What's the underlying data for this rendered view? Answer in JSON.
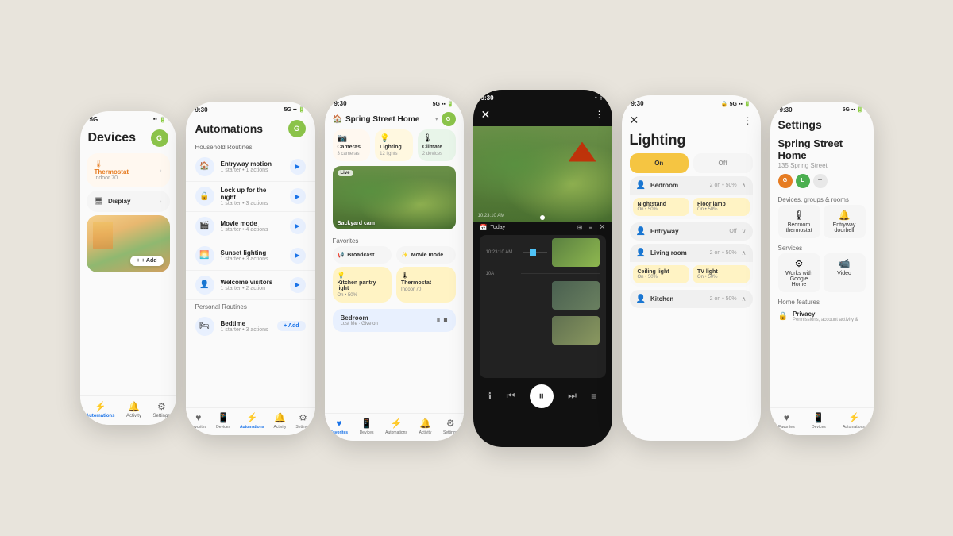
{
  "background": "#e8e4dc",
  "phones": {
    "phone1": {
      "title": "Devices",
      "status_time": "5G",
      "thermostat_label": "Thermostat",
      "thermostat_sub": "Indoor 70",
      "display_label": "Display",
      "add_label": "+ Add",
      "nav": [
        "Automations",
        "Activity",
        "Settings"
      ]
    },
    "phone2": {
      "title": "Automations",
      "status_time": "9:30",
      "section1": "Household Routines",
      "section2": "Personal Routines",
      "items": [
        {
          "name": "Entryway motion",
          "sub": "1 starter • 1 actions"
        },
        {
          "name": "Lock up for the night",
          "sub": "1 starter • 3 actions"
        },
        {
          "name": "Movie mode",
          "sub": "1 starter • 4 actions"
        },
        {
          "name": "Sunset lighting",
          "sub": "1 starter • 3 actions"
        },
        {
          "name": "Welcome visitors",
          "sub": "1 starter • 2 action"
        }
      ],
      "personal": [
        {
          "name": "Bedtime",
          "sub": "1 starter • 3 actions"
        }
      ],
      "add_label": "+ Add",
      "nav": [
        "Favorites",
        "Devices",
        "Automations",
        "Activity",
        "Settings"
      ]
    },
    "phone3": {
      "status_time": "9:30",
      "home_name": "Spring Street Home",
      "section1": "Cameras",
      "cameras_count": "3 cameras",
      "lighting_label": "Lighting",
      "lighting_count": "12 lights",
      "climate_label": "Climate",
      "climate_count": "2 devices",
      "section2": "Favorites",
      "fav1": "Broadcast",
      "fav2": "Movie mode",
      "camera_label": "Backyard cam",
      "live_badge": "Live",
      "device1": "Kitchen pantry light",
      "device1_sub": "On • 50%",
      "device2": "Thermostat",
      "device2_sub": "Indoor 70",
      "bedroom_label": "Bedroom",
      "bedroom_sub": "Lost Me · Give on",
      "nav": [
        "Favorites",
        "Devices",
        "Automations",
        "Activity",
        "Settings"
      ]
    },
    "phone4": {
      "status_time": "9:30",
      "timestamp": "10:23:10 AM",
      "date_label": "Today",
      "time1": "10:23:10 AM",
      "time2": "10A"
    },
    "phone5": {
      "status_time": "9:30",
      "title": "Lighting",
      "on_label": "On",
      "off_label": "Off",
      "bedroom_label": "Bedroom",
      "bedroom_sub": "2 on • 50%",
      "nightstand_label": "Nightstand",
      "nightstand_sub": "On • 50%",
      "floorlamp_label": "Floor lamp",
      "floorlamp_sub": "On • 50%",
      "entryway_label": "Entryway",
      "entryway_sub": "Off",
      "livingroom_label": "Living room",
      "livingroom_sub": "2 on • 50%",
      "ceiling_label": "Ceiling light",
      "ceiling_sub": "On • 50%",
      "tvlight_label": "TV light",
      "tvlight_sub": "On • 50%",
      "kitchen_label": "Kitchen",
      "kitchen_sub": "2 on • 50%"
    },
    "phone6": {
      "status_time": "9:30",
      "title": "Settings",
      "home_name": "Spring Street Home",
      "home_addr": "135 Spring Street",
      "section1": "Devices, groups & rooms",
      "room1": "Bedroom thermostat",
      "room2": "Entryway doorbell",
      "section2": "Services",
      "service1": "Works with Google Home",
      "service2": "Video",
      "section3": "Home features",
      "feature1": "Privacy",
      "feature1_sub": "Permissions, account activity &",
      "nav": [
        "Favorites",
        "Devices",
        "Automations"
      ]
    }
  }
}
